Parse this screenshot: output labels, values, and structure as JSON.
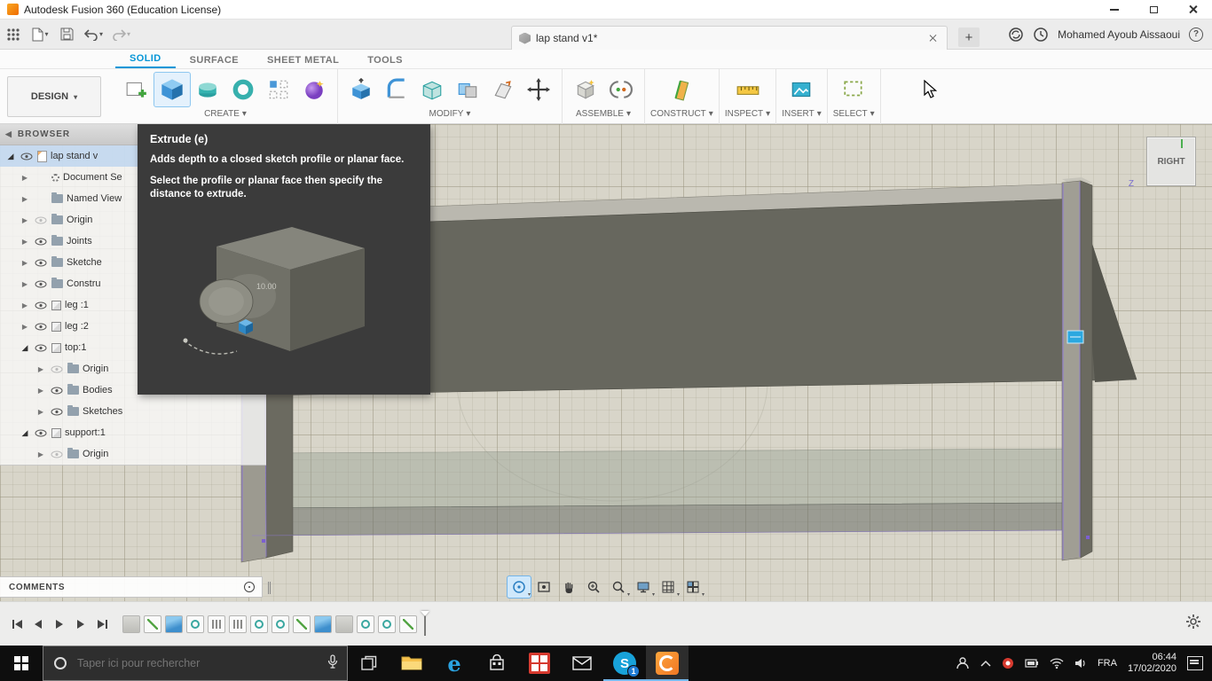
{
  "ui": {
    "chevron_down": "▾",
    "tree_collapsed": "▶",
    "tree_expanded": "◢",
    "plus": "+",
    "help": "?",
    "back": "◀"
  },
  "titlebar": {
    "title": "Autodesk Fusion 360 (Education License)"
  },
  "qat": {
    "doc_tab_label": "lap stand v1*",
    "user_name": "Mohamed Ayoub Aissaoui"
  },
  "ribbon": {
    "design_label": "DESIGN",
    "tabs": [
      "SOLID",
      "SURFACE",
      "SHEET METAL",
      "TOOLS"
    ],
    "groups": [
      "CREATE",
      "MODIFY",
      "ASSEMBLE",
      "CONSTRUCT",
      "INSPECT",
      "INSERT",
      "SELECT"
    ]
  },
  "browser": {
    "header": "BROWSER",
    "items": [
      "lap stand v",
      "Document Se",
      "Named View",
      "Origin",
      "Joints",
      "Sketche",
      "Constru",
      "leg :1",
      "leg :2",
      "top:1",
      "Origin",
      "Bodies",
      "Sketches",
      "support:1",
      "Origin"
    ]
  },
  "tooltip": {
    "title": "Extrude (e)",
    "body1": "Adds depth to a closed sketch profile or planar face.",
    "body2": "Select the profile or planar face then specify the distance to extrude.",
    "dim_label": "10.00"
  },
  "viewcube": {
    "face": "RIGHT",
    "axis_z": "Z"
  },
  "comments": {
    "label": "COMMENTS"
  },
  "taskbar": {
    "search_placeholder": "Taper ici pour rechercher",
    "skype_badge": "1",
    "language": "FRA",
    "time": "06:44",
    "date": "17/02/2020"
  },
  "colors": {
    "accent_blue": "#0696d7",
    "tooltip_bg": "#3b3b3b",
    "taskbar_bg": "#0e0e0e"
  }
}
